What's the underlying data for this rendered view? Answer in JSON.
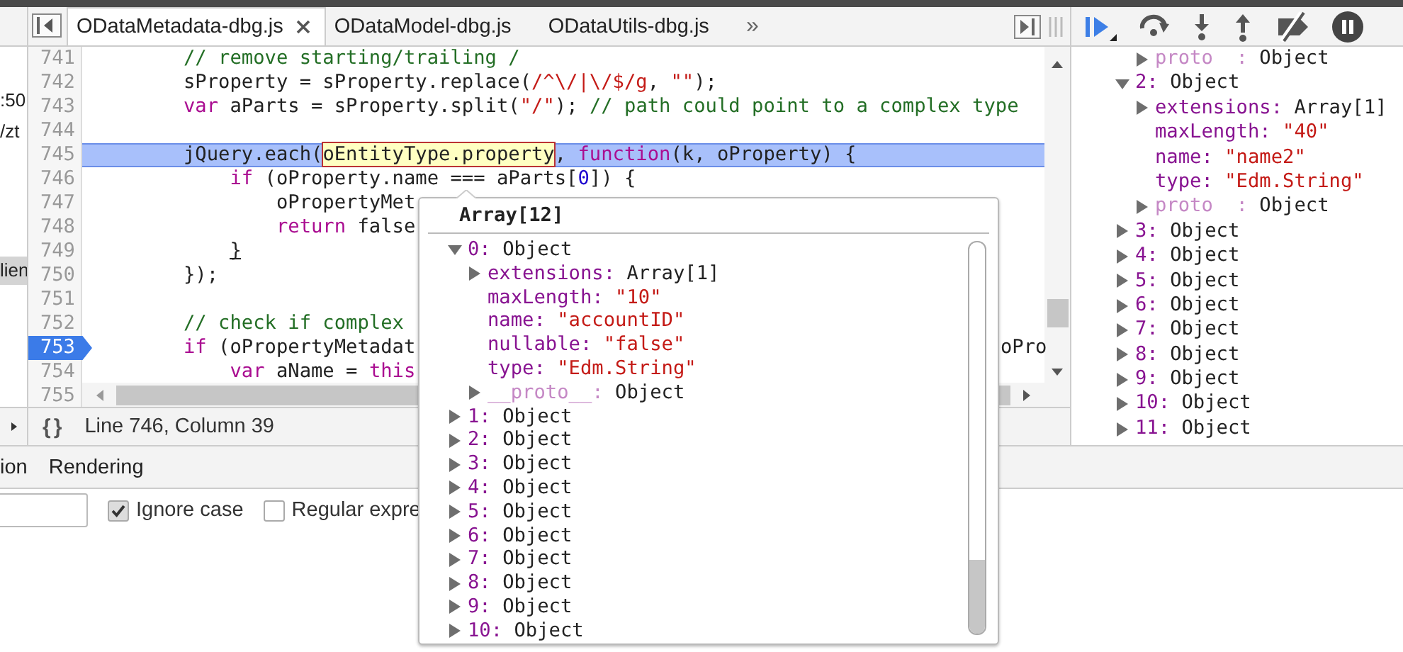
{
  "navigator": {
    "items": [
      {
        "label": ":50",
        "selected": false
      },
      {
        "label": "/zt",
        "selected": false
      },
      {
        "label": "lien",
        "selected": true
      }
    ]
  },
  "tab_bar": {
    "tabs": [
      {
        "label": "ODataMetadata-dbg.js",
        "selected": true,
        "closable": true
      },
      {
        "label": "ODataModel-dbg.js",
        "selected": false,
        "closable": false
      },
      {
        "label": "ODataUtils-dbg.js",
        "selected": false,
        "closable": false
      }
    ],
    "overflow": "»"
  },
  "editor": {
    "lines": [
      {
        "number": "741",
        "current": false,
        "breakpoint": false,
        "tokens": [
          {
            "text": "        // remove starting/trailing /",
            "kind": "comment"
          }
        ]
      },
      {
        "number": "742",
        "current": false,
        "breakpoint": false,
        "tokens": [
          {
            "text": "        sProperty = sProperty.replace(",
            "kind": "plain"
          },
          {
            "text": "/^\\/|\\/$/g",
            "kind": "string"
          },
          {
            "text": ", ",
            "kind": "plain"
          },
          {
            "text": "\"\"",
            "kind": "string"
          },
          {
            "text": ");",
            "kind": "plain"
          }
        ]
      },
      {
        "number": "743",
        "current": false,
        "breakpoint": false,
        "tokens": [
          {
            "text": "        var",
            "kind": "keyword"
          },
          {
            "text": " aParts = sProperty.split(",
            "kind": "plain"
          },
          {
            "text": "\"/\"",
            "kind": "string"
          },
          {
            "text": "); ",
            "kind": "plain"
          },
          {
            "text": "// path could point to a complex type",
            "kind": "comment"
          }
        ]
      },
      {
        "number": "744",
        "current": false,
        "breakpoint": false
      },
      {
        "number": "745",
        "current": true,
        "breakpoint": false,
        "tokens": [
          {
            "text": "        jQuery.each(",
            "kind": "plain"
          },
          {
            "text": "oEntityType.property",
            "kind": "hovered"
          },
          {
            "text": ", ",
            "kind": "plain"
          },
          {
            "text": "function",
            "kind": "keyword"
          },
          {
            "text": "(k, oProperty) {",
            "kind": "plain"
          }
        ]
      },
      {
        "number": "746",
        "current": false,
        "breakpoint": false,
        "tokens": [
          {
            "text": "            if",
            "kind": "keyword"
          },
          {
            "text": " (oProperty.name === aParts[",
            "kind": "plain"
          },
          {
            "text": "0",
            "kind": "number"
          },
          {
            "text": "]) {",
            "kind": "plain"
          }
        ]
      },
      {
        "number": "747",
        "current": false,
        "breakpoint": false,
        "tokens": [
          {
            "text": "                oPropertyMet",
            "kind": "plain"
          }
        ]
      },
      {
        "number": "748",
        "current": false,
        "breakpoint": false,
        "tokens": [
          {
            "text": "                return",
            "kind": "keyword"
          },
          {
            "text": " false",
            "kind": "plain"
          }
        ]
      },
      {
        "number": "749",
        "current": false,
        "breakpoint": false,
        "tokens": [
          {
            "text": "            }",
            "kind": "brace"
          }
        ]
      },
      {
        "number": "750",
        "current": false,
        "breakpoint": false,
        "tokens": [
          {
            "text": "        });",
            "kind": "plain"
          }
        ]
      },
      {
        "number": "751",
        "current": false,
        "breakpoint": false
      },
      {
        "number": "752",
        "current": false,
        "breakpoint": false,
        "tokens": [
          {
            "text": "        // check if complex",
            "kind": "comment"
          }
        ]
      },
      {
        "number": "753",
        "current": false,
        "breakpoint": true,
        "tokens": [
          {
            "text": "        if",
            "kind": "keyword"
          },
          {
            "text": " (oPropertyMetadat",
            "kind": "plain"
          }
        ],
        "right_tokens": [
          {
            "text": "oPro",
            "kind": "plain"
          }
        ]
      },
      {
        "number": "754",
        "current": false,
        "breakpoint": false,
        "tokens": [
          {
            "text": "            var",
            "kind": "keyword"
          },
          {
            "text": " aName = ",
            "kind": "plain"
          },
          {
            "text": "this",
            "kind": "keyword"
          }
        ]
      },
      {
        "number": "755",
        "current": false,
        "breakpoint": false
      }
    ]
  },
  "status_bar": {
    "format_button": "{}",
    "cursor": "Line 746, Column 39"
  },
  "drawer": {
    "tabs": [
      {
        "label": "ion",
        "selected": false
      },
      {
        "label": "Rendering",
        "selected": false
      }
    ],
    "search": {
      "options": [
        {
          "label": "Ignore case",
          "checked": true
        },
        {
          "label": "Regular expre",
          "checked": false
        }
      ]
    }
  },
  "sidebar": {
    "leading_children": [
      {
        "key": "proto  :",
        "value": "Object",
        "kind": "internal",
        "expanded": false
      }
    ],
    "items": [
      {
        "key": "2:",
        "value": "Object",
        "kind": "object",
        "expanded": true,
        "children": [
          {
            "key": "extensions:",
            "value": "Array[1]",
            "kind": "object",
            "expanded": false
          },
          {
            "key": "maxLength:",
            "value": "\"40\"",
            "kind": "string"
          },
          {
            "key": "name:",
            "value": "\"name2\"",
            "kind": "string"
          },
          {
            "key": "type:",
            "value": "\"Edm.String\"",
            "kind": "string"
          },
          {
            "key": "proto  :",
            "value": "Object",
            "kind": "internal",
            "expanded": false
          }
        ]
      },
      {
        "key": "3:",
        "value": "Object",
        "kind": "object",
        "expanded": false
      },
      {
        "key": "4:",
        "value": "Object",
        "kind": "object",
        "expanded": false
      },
      {
        "key": "5:",
        "value": "Object",
        "kind": "object",
        "expanded": false
      },
      {
        "key": "6:",
        "value": "Object",
        "kind": "object",
        "expanded": false
      },
      {
        "key": "7:",
        "value": "Object",
        "kind": "object",
        "expanded": false
      },
      {
        "key": "8:",
        "value": "Object",
        "kind": "object",
        "expanded": false
      },
      {
        "key": "9:",
        "value": "Object",
        "kind": "object",
        "expanded": false
      },
      {
        "key": "10:",
        "value": "Object",
        "kind": "object",
        "expanded": false
      },
      {
        "key": "11:",
        "value": "Object",
        "kind": "object",
        "expanded": false
      }
    ]
  },
  "popover": {
    "title": "Array[12]",
    "items": [
      {
        "key": "0:",
        "value": "Object",
        "kind": "object",
        "expanded": true,
        "children": [
          {
            "key": "extensions:",
            "value": "Array[1]",
            "kind": "object",
            "expanded": false
          },
          {
            "key": "maxLength:",
            "value": "\"10\"",
            "kind": "string"
          },
          {
            "key": "name:",
            "value": "\"accountID\"",
            "kind": "string"
          },
          {
            "key": "nullable:",
            "value": "\"false\"",
            "kind": "string"
          },
          {
            "key": "type:",
            "value": "\"Edm.String\"",
            "kind": "string"
          },
          {
            "key": "__proto__:",
            "value": "Object",
            "kind": "internal",
            "expanded": false
          }
        ]
      },
      {
        "key": "1:",
        "value": "Object",
        "kind": "object",
        "expanded": false
      },
      {
        "key": "2:",
        "value": "Object",
        "kind": "object",
        "expanded": false
      },
      {
        "key": "3:",
        "value": "Object",
        "kind": "object",
        "expanded": false
      },
      {
        "key": "4:",
        "value": "Object",
        "kind": "object",
        "expanded": false
      },
      {
        "key": "5:",
        "value": "Object",
        "kind": "object",
        "expanded": false
      },
      {
        "key": "6:",
        "value": "Object",
        "kind": "object",
        "expanded": false
      },
      {
        "key": "7:",
        "value": "Object",
        "kind": "object",
        "expanded": false
      },
      {
        "key": "8:",
        "value": "Object",
        "kind": "object",
        "expanded": false
      },
      {
        "key": "9:",
        "value": "Object",
        "kind": "object",
        "expanded": false
      },
      {
        "key": "10:",
        "value": "Object",
        "kind": "object",
        "expanded": false
      }
    ]
  }
}
